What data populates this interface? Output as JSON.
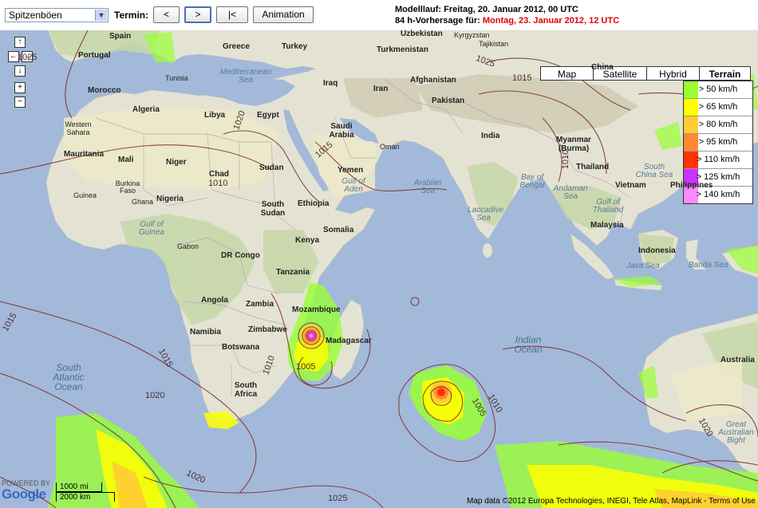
{
  "toolbar": {
    "parameter_select": "Spitzenböen",
    "termin_label": "Termin:",
    "prev_button": "<",
    "next_button": ">",
    "first_button": "|<",
    "animation_button": "Animation",
    "run_line_label": "Modelllauf:",
    "run_line_value": "Freitag, 20. Januar 2012, 00 UTC",
    "forecast_label": "84 h-Vorhersage für:",
    "forecast_value": "Montag, 23. Januar 2012, 12 UTC"
  },
  "map_types": [
    "Map",
    "Satellite",
    "Hybrid",
    "Terrain"
  ],
  "active_map_type": "Terrain",
  "legend": [
    {
      "label": "> 50 km/h",
      "color": "#99ff33"
    },
    {
      "label": "> 65 km/h",
      "color": "#ffff00"
    },
    {
      "label": "> 80 km/h",
      "color": "#ffcc33"
    },
    {
      "label": "> 95 km/h",
      "color": "#ff8833"
    },
    {
      "label": "> 110 km/h",
      "color": "#ff3300"
    },
    {
      "label": "> 125 km/h",
      "color": "#cc33ff"
    },
    {
      "label": "> 140 km/h",
      "color": "#ff88ff"
    }
  ],
  "nav": {
    "up": "↑",
    "left": "←",
    "right": "→",
    "down": "↓",
    "zoom_in": "+",
    "zoom_out": "−"
  },
  "labels": {
    "countries": [
      "Spain",
      "Portugal",
      "Morocco",
      "Algeria",
      "Libya",
      "Egypt",
      "Western Sahara",
      "Mauritania",
      "Mali",
      "Niger",
      "Chad",
      "Sudan",
      "South Sudan",
      "Nigeria",
      "Guinea",
      "Burkina Faso",
      "Ghana",
      "Gabon",
      "DR Congo",
      "Ethiopia",
      "Somalia",
      "Kenya",
      "Tanzania",
      "Angola",
      "Zambia",
      "Mozambique",
      "Namibia",
      "Zimbabwe",
      "Botswana",
      "South Africa",
      "Madagascar",
      "Greece",
      "Turkey",
      "Iraq",
      "Iran",
      "Saudi Arabia",
      "Oman",
      "Yemen",
      "Uzbekistan",
      "Kyrgyzstan",
      "Turkmenistan",
      "Afghanistan",
      "Pakistan",
      "India",
      "China",
      "Myanmar (Burma)",
      "Thailand",
      "Vietnam",
      "Philippines",
      "Malaysia",
      "Indonesia",
      "Australia",
      "Tunisia",
      "Tajikistan"
    ],
    "seas": [
      "Mediterranean Sea",
      "Gulf of Guinea",
      "Gulf of Aden",
      "Arabian Sea",
      "Laccadive Sea",
      "Bay of Bengal",
      "Andaman Sea",
      "Gulf of Thailand",
      "South China Sea",
      "Java Sea",
      "Banda Sea",
      "Great Australian Bight"
    ],
    "oceans": [
      "South Atlantic Ocean",
      "Indian Ocean"
    ],
    "isobars": [
      "1025",
      "1020",
      "1015",
      "1010",
      "1005",
      "1010",
      "1015",
      "1020",
      "1025",
      "1020",
      "1015",
      "1010",
      "1015",
      "1020",
      "1025",
      "1005",
      "1010"
    ]
  },
  "attribution": {
    "powered_by": "POWERED BY",
    "logo": "Google",
    "scale_mi": "1000 mi",
    "scale_km": "2000 km",
    "copyright": "Map data ©2012 Europa Technologies, INEGI, Tele Atlas, MapLink - Terms of Use"
  }
}
